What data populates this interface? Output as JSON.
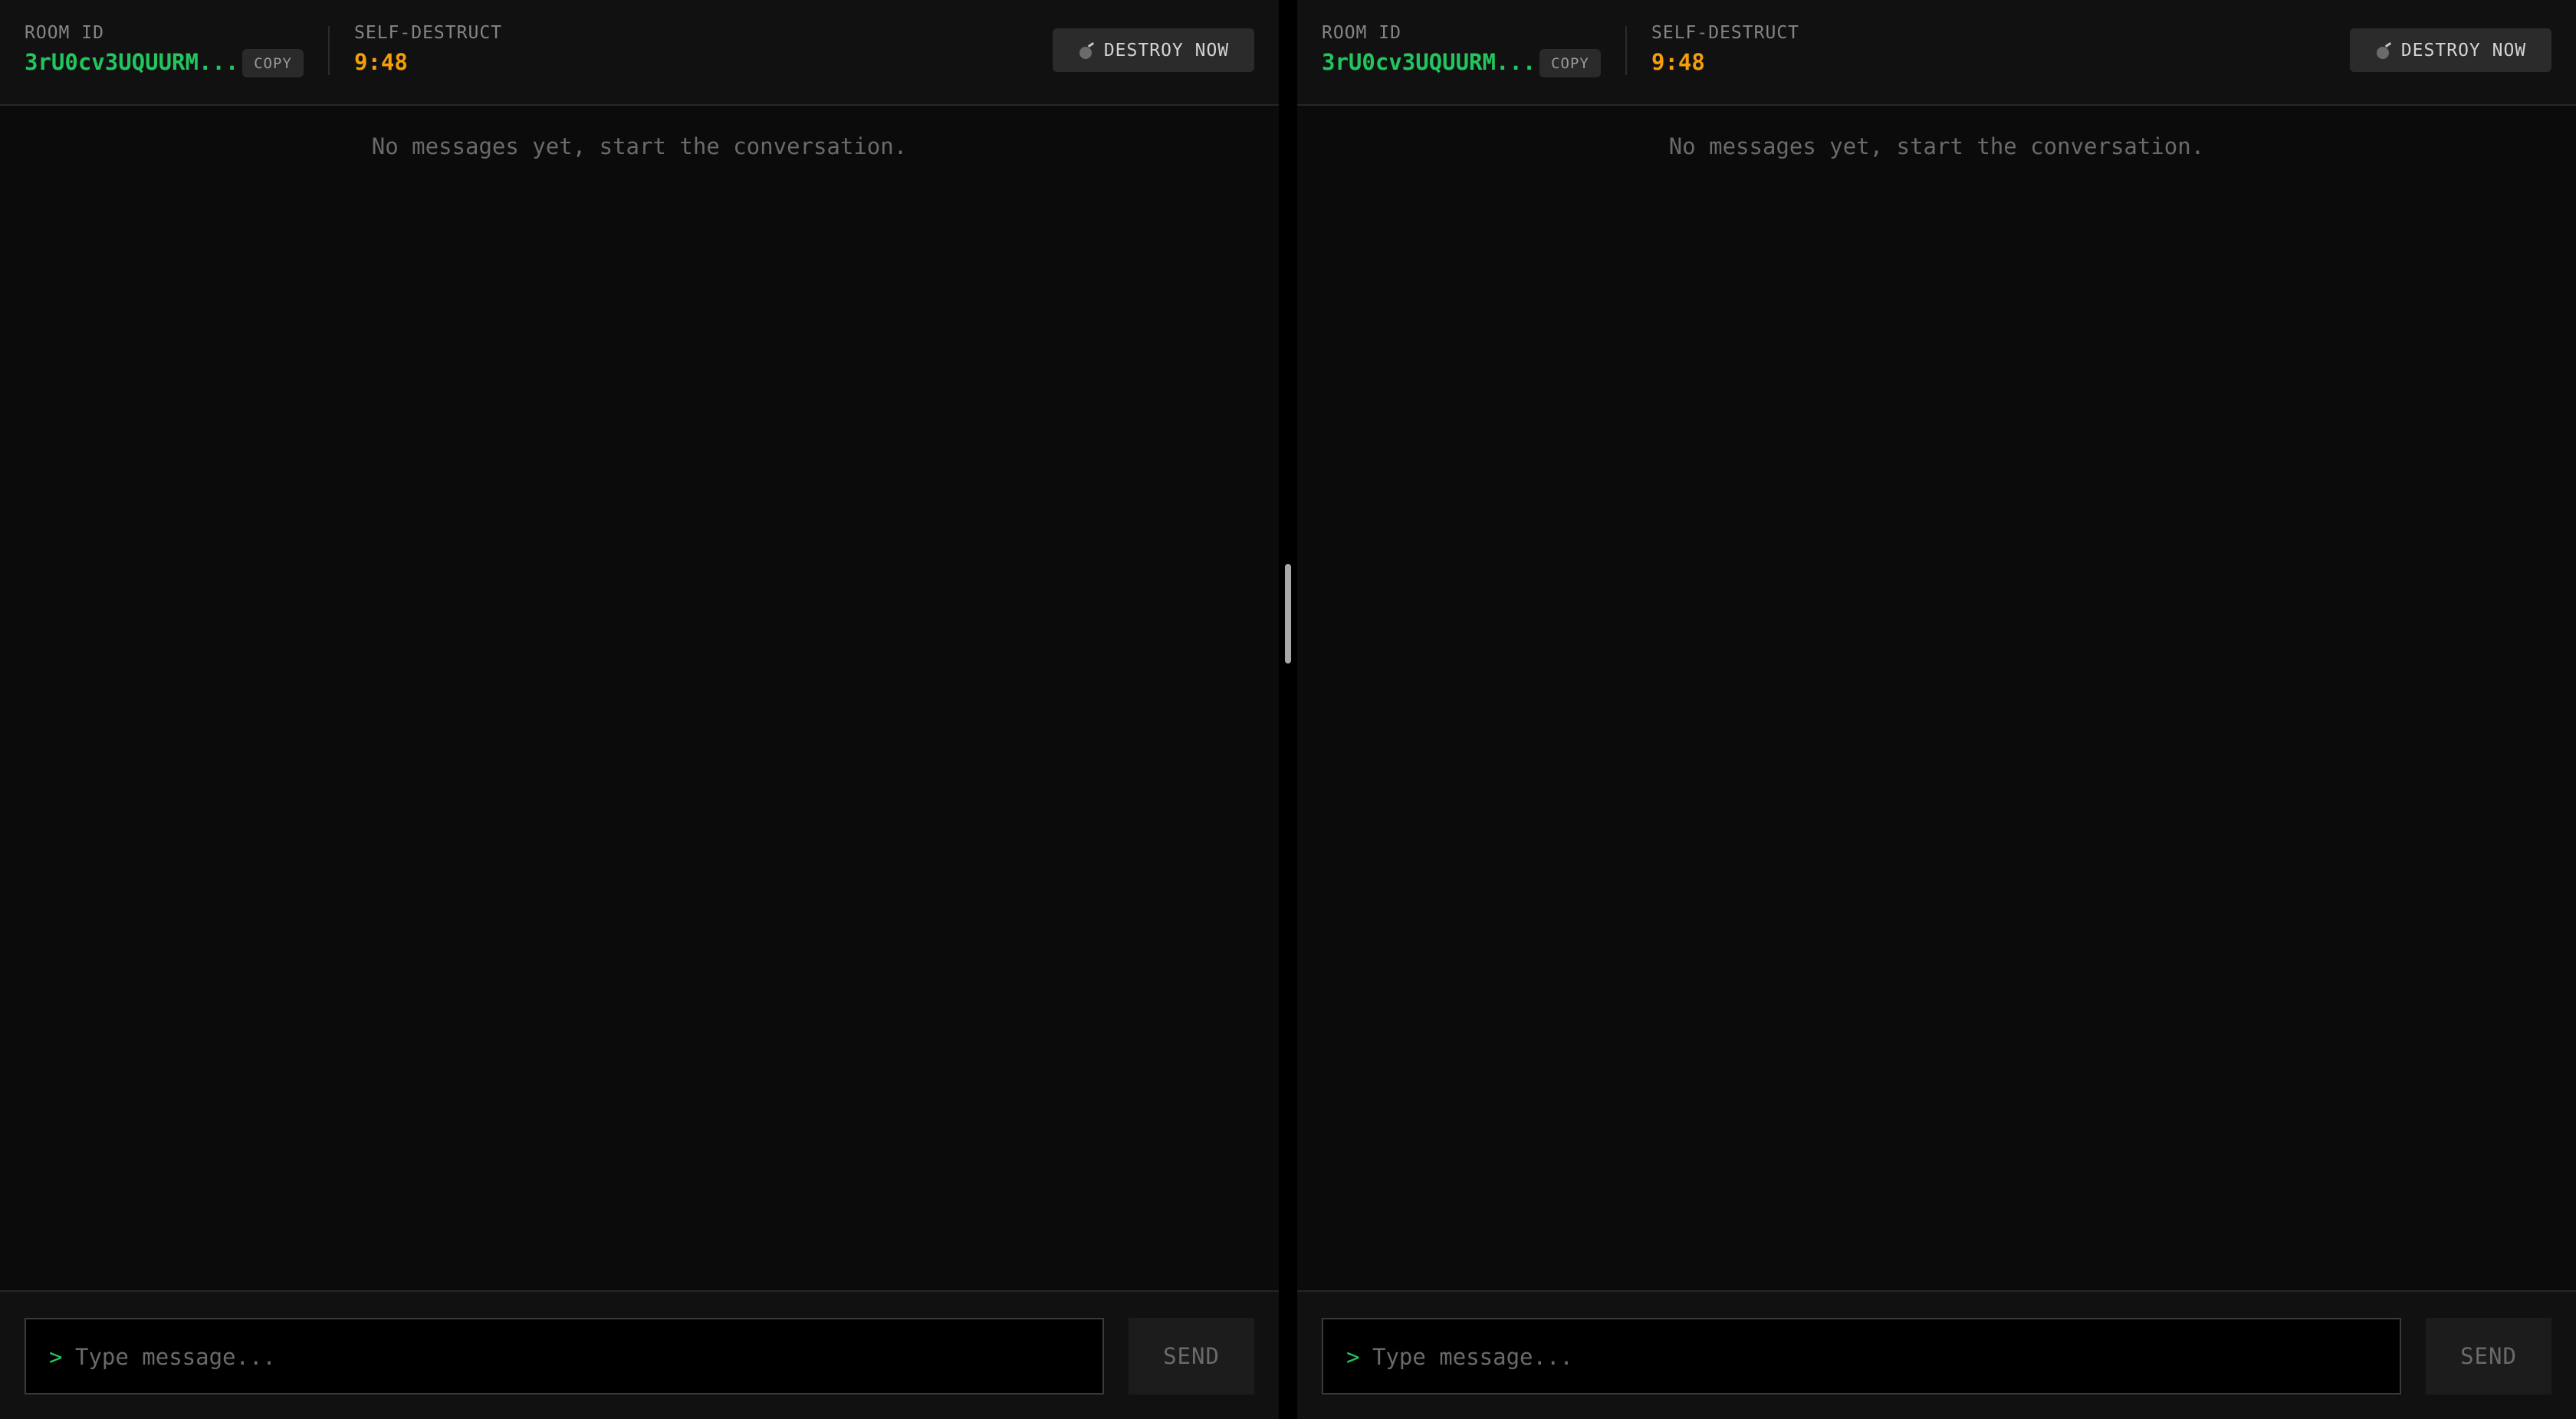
{
  "panes": [
    {
      "header": {
        "room_label": "ROOM ID",
        "room_id": "3rU0cv3UQUURM...",
        "copy_label": "COPY",
        "self_destruct_label": "SELF-DESTRUCT",
        "timer": "9:48",
        "destroy_label": "DESTROY NOW",
        "destroy_icon": "bomb-icon"
      },
      "messages": {
        "empty_text": "No messages yet, start the conversation."
      },
      "composer": {
        "prompt": ">",
        "placeholder": "Type message...",
        "value": "",
        "send_label": "SEND"
      }
    },
    {
      "header": {
        "room_label": "ROOM ID",
        "room_id": "3rU0cv3UQUURM...",
        "copy_label": "COPY",
        "self_destruct_label": "SELF-DESTRUCT",
        "timer": "9:48",
        "destroy_label": "DESTROY NOW",
        "destroy_icon": "bomb-icon"
      },
      "messages": {
        "empty_text": "No messages yet, start the conversation."
      },
      "composer": {
        "prompt": ">",
        "placeholder": "Type message...",
        "value": "",
        "send_label": "SEND"
      }
    }
  ],
  "colors": {
    "room_id": "#22c55e",
    "timer": "#f59e0b",
    "background": "#0b0b0b"
  }
}
